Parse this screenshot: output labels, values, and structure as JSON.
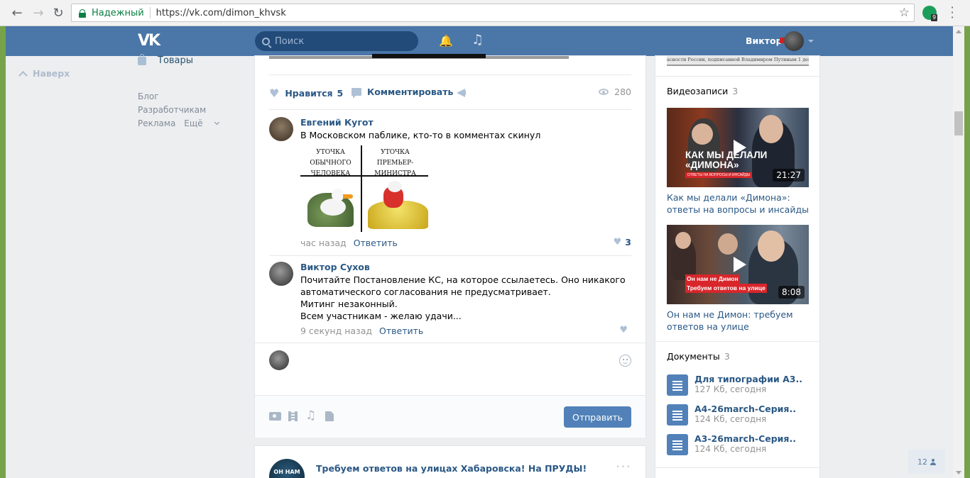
{
  "browser": {
    "secure_label": "Надежный",
    "url": "https://vk.com/dimon_khvsk",
    "extension_badge": "9"
  },
  "header": {
    "logo": "VK",
    "search_placeholder": "Поиск",
    "user_name": "Виктор"
  },
  "sidebar": {
    "up_label": "Наверх",
    "goods_label": "Товары",
    "footer": [
      "Блог",
      "Разработчикам",
      "Реклама",
      "Ещё"
    ]
  },
  "post": {
    "like_label": "Нравится",
    "like_count": "5",
    "comment_label": "Комментировать",
    "views": "280",
    "comments": [
      {
        "author": "Евгений Кугот",
        "text": "В Московском паблике, кто-то в комментах скинул",
        "meme_left": "УТОЧКА\nОБЫЧНОГО ЧЕЛОВЕКА",
        "meme_right": "УТОЧКА\nПРЕМЬЕР-МИНИСТРА",
        "time": "час назад",
        "reply": "Ответить",
        "likes": "3"
      },
      {
        "author": "Виктор Сухов",
        "text": "Почитайте Постановление КС, на которое ссылаетесь. Оно никакого автоматического согласования не предусматривает.\nМитинг незаконный.\nВсем участникам - желаю удачи...",
        "time": "9 секунд назад",
        "reply": "Ответить"
      }
    ],
    "send_label": "Отправить"
  },
  "post2": {
    "avatar_text": "ОН НАМ",
    "title": "Требуем ответов на улицах Хабаровска! На ПРУДЫ!"
  },
  "right": {
    "top_thumb_text": "асности России, подписанной Владимиром Путиным 1 декабр",
    "videos_header": "Видеозаписи",
    "videos_count": "3",
    "videos": [
      {
        "overlay": "КАК МЫ ДЕЛАЛИ\n«ДИМОНА»",
        "overlay_sub": "ОТВЕТЫ НА ВОПРОСЫ И ИНСАЙДЫ",
        "duration": "21:27",
        "title": "Как мы делали «Димона»: ответы на вопросы и инсайды"
      },
      {
        "overlay_line1": "Он нам не Димон",
        "overlay_line2": "Требуем ответов на улице",
        "duration": "8:08",
        "title": "Он нам не Димон: требуем ответов на улице"
      }
    ],
    "docs_header": "Документы",
    "docs_count": "3",
    "docs": [
      {
        "name": "Для типографии А3..",
        "meta": "127 Кб, сегодня"
      },
      {
        "name": "А4-26march-Серия..",
        "meta": "124 Кб, сегодня"
      },
      {
        "name": "А3-26march-Серия..",
        "meta": "124 Кб, сегодня"
      }
    ]
  },
  "chat": {
    "count": "12"
  }
}
